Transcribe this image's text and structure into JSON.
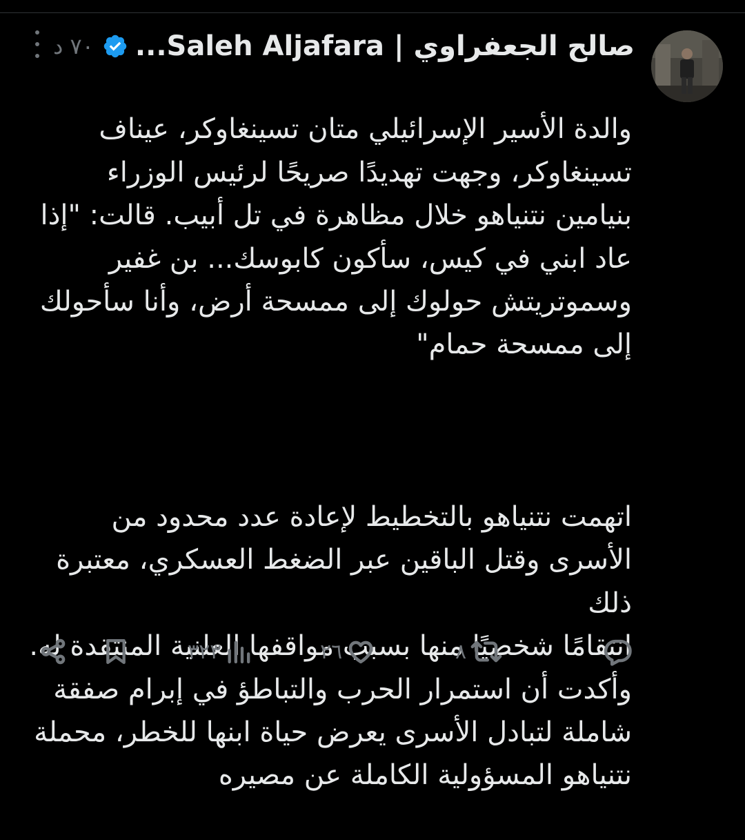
{
  "author": {
    "display_name": "صالح الجعفراوي | Saleh Aljafara...",
    "verified": true,
    "post_time": "٧٠ د"
  },
  "tweet": {
    "paragraph1": "والدة الأسير الإسرائيلي متان تسينغاوكر، عيناف\nتسينغاوكر، وجهت تهديدًا صريحًا لرئيس الوزراء\nبنيامين نتنياهو خلال مظاهرة في تل أبيب. قالت: \"إذا\nعاد ابني في كيس، سأكون كابوسك... بن غفير\nوسموتريتش حولوك إلى ممسحة أرض، وأنا سأحولك\nإلى ممسحة حمام\"",
    "paragraph2": "اتهمت نتنياهو بالتخطيط لإعادة عدد محدود من\nالأسرى وقتل الباقين عبر الضغط العسكري، معتبرة ذلك\nانتقامًا شخصيًا منها بسبب مواقفها العلنية المنتقدة له.\nوأكدت أن استمرار الحرب والتباطؤ في إبرام صفقة\nشاملة لتبادل الأسرى يعرض حياة ابنها للخطر، محملة\nنتنياهو المسؤولية الكاملة عن مصيره"
  },
  "actions": {
    "replies": "",
    "reposts": "٨",
    "likes": "٢٦",
    "views": "٣٢٣"
  },
  "colors": {
    "background": "#000000",
    "text": "#e7e9ea",
    "secondary": "#71767b",
    "verified_blue": "#1d9bf0"
  },
  "icons": [
    "more-icon",
    "verified-badge-icon",
    "reply-icon",
    "repost-icon",
    "like-icon",
    "views-icon",
    "bookmark-icon",
    "share-icon"
  ]
}
